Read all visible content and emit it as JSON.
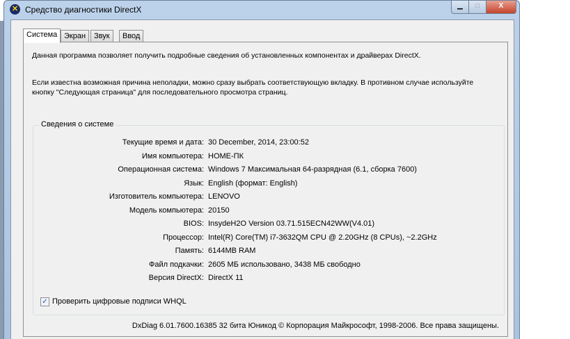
{
  "window": {
    "title": "Средство диагностики DirectX",
    "min": "▁",
    "max": "□",
    "close": "X"
  },
  "tabs": [
    "Система",
    "Экран",
    "Звук",
    "Ввод"
  ],
  "intro1": "Данная программа позволяет получить подробные сведения об установленных компонентах и драйверах DirectX.",
  "intro2": "Если известна возможная причина неполадки, можно сразу выбрать соответствующую вкладку. В противном случае используйте",
  "intro3": "кнопку \"Следующая страница\" для последовательного просмотра страниц.",
  "group": {
    "title": "Сведения о системе",
    "rows": [
      {
        "k": "Текущие время и дата:",
        "v": "30 December, 2014, 23:00:52"
      },
      {
        "k": "Имя компьютера:",
        "v": "HOME-ПК"
      },
      {
        "k": "Операционная система:",
        "v": "Windows 7 Максимальная 64-разрядная (6.1, сборка 7600)"
      },
      {
        "k": "Язык:",
        "v": "English (формат: English)"
      },
      {
        "k": "Изготовитель компьютера:",
        "v": "LENOVO"
      },
      {
        "k": "Модель компьютера:",
        "v": "20150"
      },
      {
        "k": "BIOS:",
        "v": "InsydeH2O Version 03.71.515ECN42WW(V4.01)"
      },
      {
        "k": "Процессор:",
        "v": "Intel(R) Core(TM) i7-3632QM CPU @ 2.20GHz (8 CPUs), ~2.2GHz"
      },
      {
        "k": "Память:",
        "v": "6144MB RAM"
      },
      {
        "k": "Файл подкачки:",
        "v": "2605 МБ использовано, 3438 МБ свободно"
      },
      {
        "k": "Версия DirectX:",
        "v": "DirectX 11"
      }
    ]
  },
  "whql": {
    "label": "Проверить цифровые подписи WHQL",
    "checked": true
  },
  "footer": "DxDiag 6.01.7600.16385 32 бита Юникод  © Корпорация Майкрософт, 1998-2006.  Все права защищены."
}
